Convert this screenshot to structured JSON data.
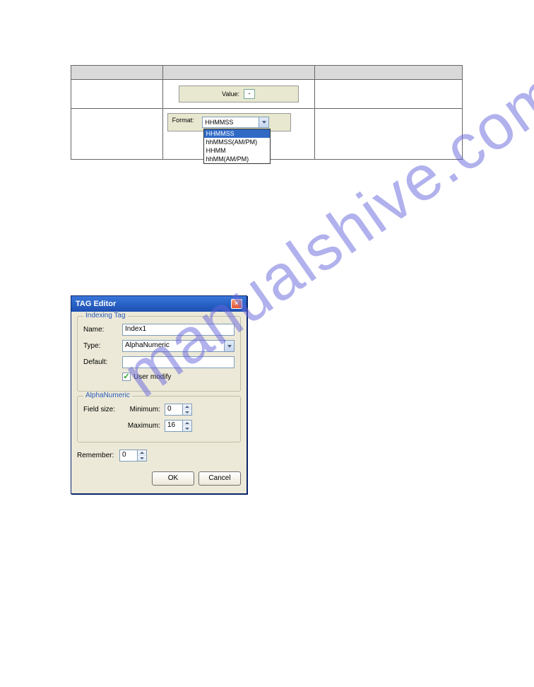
{
  "watermark": "manualshive.com",
  "table": {
    "value_label": "Value:",
    "value_input": "-",
    "format_label": "Format:",
    "format_selected": "HHMMSS",
    "format_options": [
      "HHMMSS",
      "hhMMSS(AM/PM)",
      "HHMM",
      "hhMM(AM/PM)"
    ]
  },
  "dialog": {
    "title": "TAG Editor",
    "indexing_tag": {
      "legend": "Indexing Tag",
      "name_label": "Name:",
      "name_value": "Index1",
      "type_label": "Type:",
      "type_value": "AlphaNumeric",
      "default_label": "Default:",
      "default_value": "",
      "user_modify_label": "User modify",
      "user_modify_checked": true
    },
    "alphanumeric": {
      "legend": "AlphaNumeric",
      "field_size_label": "Field size:",
      "min_label": "Minimum:",
      "min_value": "0",
      "max_label": "Maximum:",
      "max_value": "16"
    },
    "remember_label": "Remember:",
    "remember_value": "0",
    "ok_label": "OK",
    "cancel_label": "Cancel"
  }
}
